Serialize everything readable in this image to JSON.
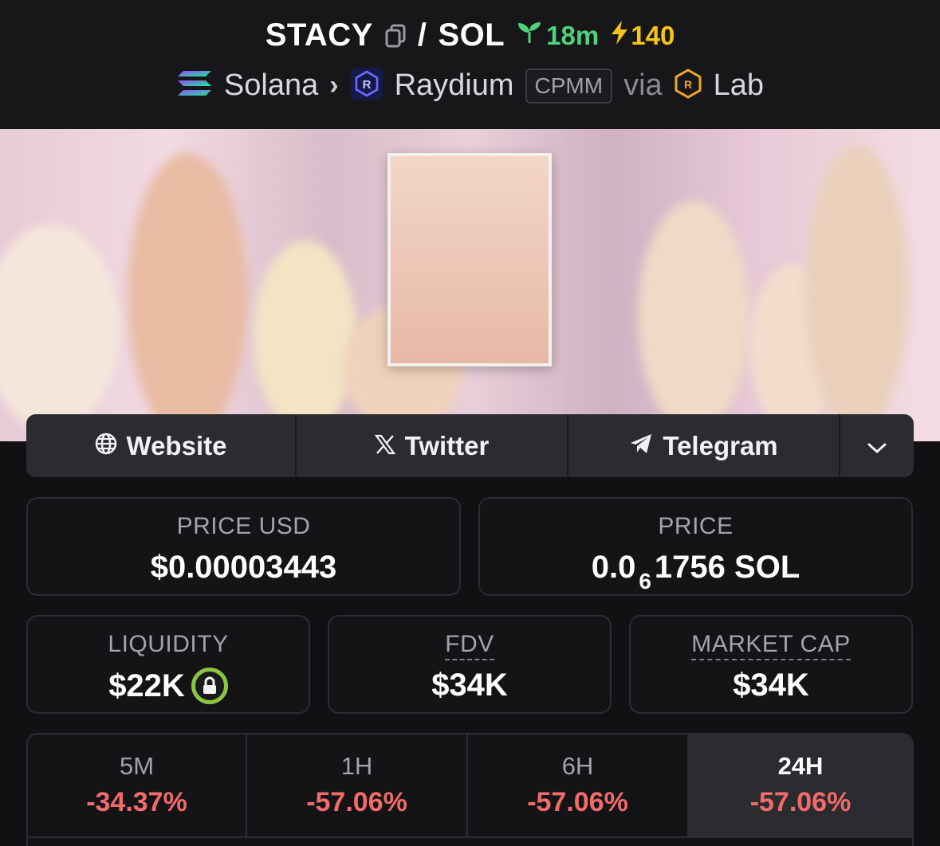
{
  "pair": {
    "base": "STACY",
    "separator": "/",
    "quote": "SOL",
    "age": "18m",
    "boosts": "140"
  },
  "route": {
    "chain": "Solana",
    "dex": "Raydium",
    "pool_type": "CPMM",
    "via": "via",
    "launchpad": "Lab"
  },
  "links": {
    "website": "Website",
    "twitter": "Twitter",
    "telegram": "Telegram"
  },
  "stats": {
    "price_usd_label": "PRICE USD",
    "price_usd": "$0.00003443",
    "price_label": "PRICE",
    "price_prefix": "0.0",
    "price_zero_count": "6",
    "price_suffix": "1756 SOL",
    "liquidity_label": "LIQUIDITY",
    "liquidity": "$22K",
    "fdv_label": "FDV",
    "fdv": "$34K",
    "market_cap_label": "MARKET CAP",
    "market_cap": "$34K"
  },
  "changes": [
    {
      "period": "5M",
      "value": "-34.37%"
    },
    {
      "period": "1H",
      "value": "-57.06%"
    },
    {
      "period": "6H",
      "value": "-57.06%"
    },
    {
      "period": "24H",
      "value": "-57.06%"
    }
  ],
  "colors": {
    "positive_age": "#4fd17a",
    "boost": "#f5c518",
    "negative": "#f26b6b",
    "lock_ring": "#8cc63f"
  },
  "icons": [
    "copy-icon",
    "sprout-icon",
    "lightning-icon",
    "solana-icon",
    "raydium-icon",
    "lab-icon",
    "globe-icon",
    "x-icon",
    "telegram-icon",
    "chevron-down-icon",
    "lock-icon"
  ]
}
